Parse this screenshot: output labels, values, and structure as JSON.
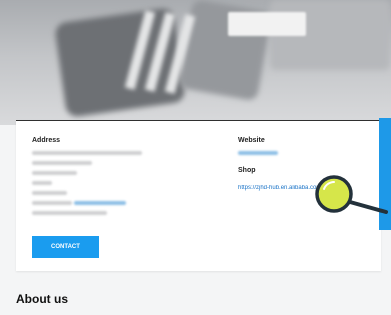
{
  "address": {
    "label": "Address"
  },
  "website": {
    "label": "Website"
  },
  "shop": {
    "label": "Shop",
    "url": "https://zjhd-hub.en.alibaba.com?spm=a2..."
  },
  "contact_button": {
    "label": "CONTACT"
  },
  "about": {
    "title": "About us"
  },
  "colors": {
    "accent": "#1a9cef",
    "magnifier": "#d6e64a"
  }
}
